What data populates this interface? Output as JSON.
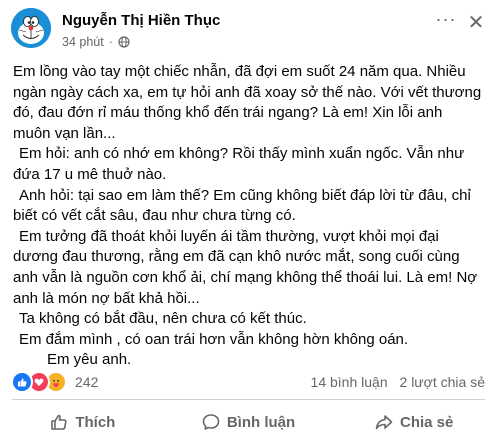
{
  "post": {
    "author": "Nguyễn Thị Hiền Thục",
    "time": "34 phút",
    "dot": "·",
    "privacy_icon": "globe-icon",
    "more_label": "···",
    "close_label": "✕",
    "lines": [
      "Em lồng vào tay một chiếc nhẫn, đã đợi em suốt 24 năm qua. Nhiều",
      "ngàn ngày cách xa, em tự hỏi anh đã xoay sở thế nào. Với vết thương",
      "đó, đau đớn rỉ máu thống khổ đến trái ngang? Là em! Xin lỗi anh",
      "muôn vạn lần...",
      "Em hỏi: anh có nhớ em không? Rồi thấy mình  xuẩn ngốc. Vẫn như",
      "đứa 17 u mê thuở nào.",
      "Anh hỏi: tại sao em làm thế? Em cũng không biết đáp lời từ đâu, chỉ",
      "biết có vết cắt sâu, đau như chưa từng có.",
      "Em tưởng đã thoát khỏi luyến ái tầm thường, vượt khỏi mọi đại",
      "dương đau thương, rằng em đã cạn khô nước mắt, song cuối cùng",
      "anh vẫn là nguồn cơn khổ ải, chí mạng không thể thoái lui. Là em! Nợ",
      "anh là món nợ bất khả hồi...",
      "Ta không có bắt đầu, nên chưa có kết thúc.",
      "Em đắm mình , có oan trái hơn vẫn không hờn không oán.",
      "Em yêu anh."
    ]
  },
  "reactions": {
    "icons": [
      "like-icon",
      "love-icon",
      "care-icon"
    ],
    "count": "242",
    "comments": "14 bình luận",
    "shares": "2 lượt chia sẻ"
  },
  "actions": {
    "like": "Thích",
    "comment": "Bình luận",
    "share": "Chia sẻ"
  },
  "colors": {
    "like": "#1877f2",
    "love": "#f33e58",
    "care": "#f7b125",
    "secondary_text": "#65676b"
  }
}
